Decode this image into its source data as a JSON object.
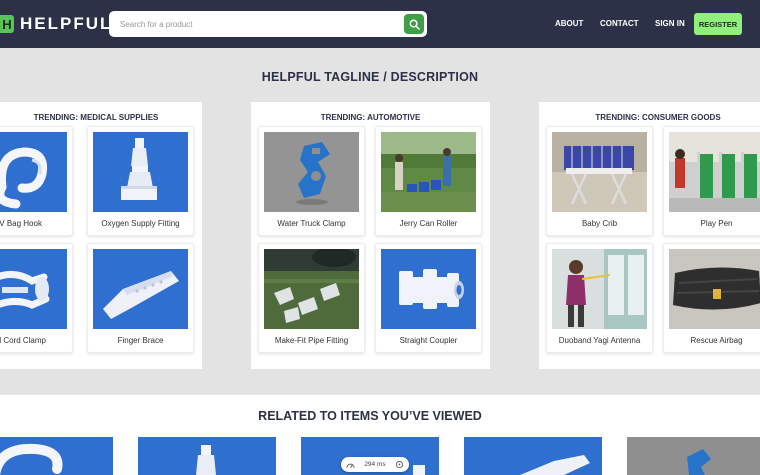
{
  "header": {
    "logo_mark": "H",
    "logo_text": "HELPFUL",
    "search_placeholder": "Search for a product",
    "nav": {
      "about": "ABOUT",
      "contact": "CONTACT",
      "sign_in": "SIGN IN",
      "register": "REGISTER"
    }
  },
  "tagline": "HELPFUL TAGLINE / DESCRIPTION",
  "trending": [
    {
      "title": "TRENDING: MEDICAL SUPPLIES",
      "items": [
        "IV Bag Hook",
        "Oxygen Supply Fitting",
        "Umbilical Cord Clamp",
        "Finger Brace"
      ]
    },
    {
      "title": "TRENDING: AUTOMOTIVE",
      "items": [
        "Water Truck Clamp",
        "Jerry Can Roller",
        "Make-Fit Pipe Fitting",
        "Straight Coupler"
      ]
    },
    {
      "title": "TRENDING: CONSUMER GOODS",
      "items": [
        "Baby Crib",
        "Play Pen",
        "Duoband Yagi Antenna",
        "Rescue Airbag"
      ]
    }
  ],
  "related_title": "RELATED TO ITEMS YOU’VE VIEWED",
  "zoom": {
    "value": "294 ms"
  },
  "colors": {
    "header_bg": "#2c3147",
    "accent_green": "#3f9f48",
    "register_bg": "#8ff07c",
    "product_blue": "#2f6fd0"
  }
}
